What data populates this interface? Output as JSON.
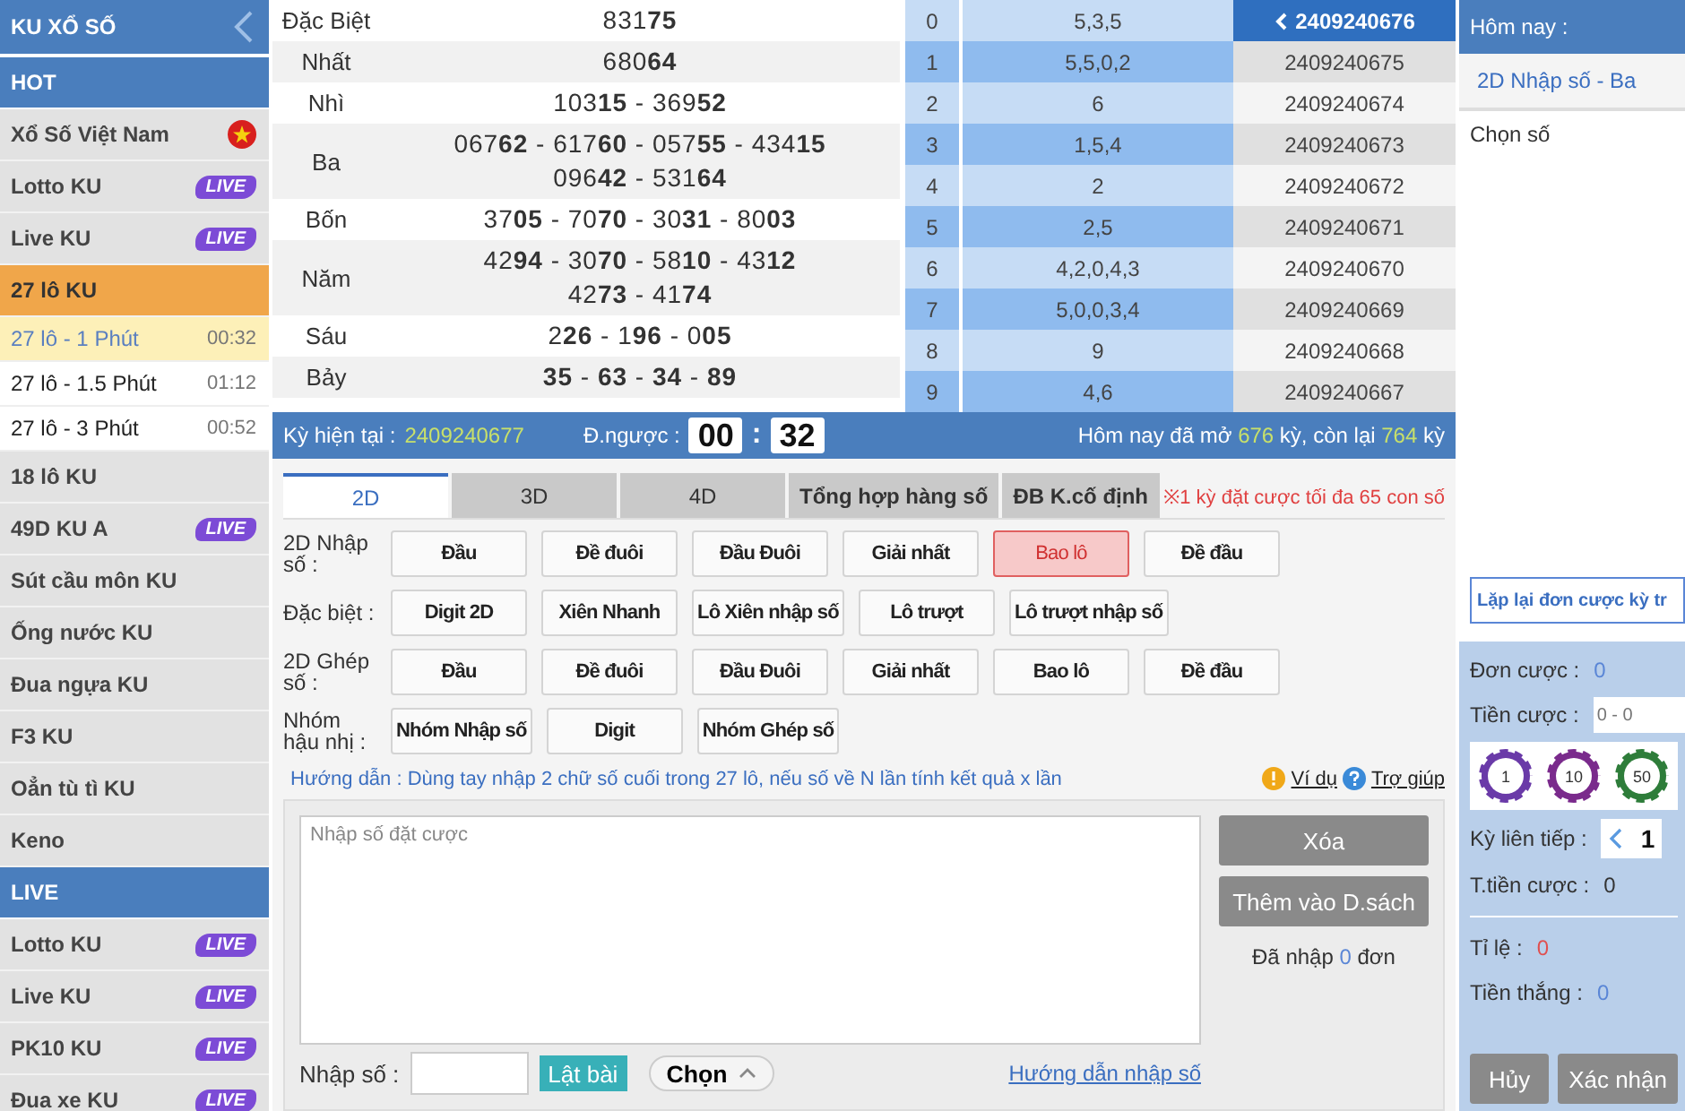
{
  "sidebar": {
    "title": "KU XỔ SỐ",
    "items": [
      {
        "kind": "section",
        "label": "HOT"
      },
      {
        "kind": "flag",
        "label": "Xổ Số Việt Nam",
        "selected": false
      },
      {
        "kind": "item",
        "label": "Lotto KU",
        "badge": "LIVE",
        "selected": false
      },
      {
        "kind": "item",
        "label": "Live KU",
        "badge": "LIVE",
        "selected": false
      },
      {
        "kind": "item",
        "label": "27 lô KU",
        "selected": true,
        "children": [
          {
            "label": "27 lô - 1 Phút",
            "time": "00:32",
            "selected": true
          },
          {
            "label": "27 lô - 1.5 Phút",
            "time": "01:12",
            "selected": false
          },
          {
            "label": "27 lô - 3 Phút",
            "time": "00:52",
            "selected": false
          }
        ]
      },
      {
        "kind": "item",
        "label": "18 lô KU",
        "selected": false
      },
      {
        "kind": "item",
        "label": "49D KU A",
        "badge": "LIVE",
        "selected": false
      },
      {
        "kind": "item",
        "label": "Sút cầu môn KU",
        "selected": false
      },
      {
        "kind": "item",
        "label": "Ống nước KU",
        "selected": false
      },
      {
        "kind": "item",
        "label": "Đua ngựa KU",
        "selected": false
      },
      {
        "kind": "item",
        "label": "F3 KU",
        "selected": false
      },
      {
        "kind": "item",
        "label": "Oẳn tù tì KU",
        "selected": false
      },
      {
        "kind": "item",
        "label": "Keno",
        "selected": false
      },
      {
        "kind": "section",
        "label": "LIVE"
      },
      {
        "kind": "item",
        "label": "Lotto KU",
        "badge": "LIVE",
        "selected": false
      },
      {
        "kind": "item",
        "label": "Live KU",
        "badge": "LIVE",
        "selected": false
      },
      {
        "kind": "item",
        "label": "PK10 KU",
        "badge": "LIVE",
        "selected": false
      },
      {
        "kind": "item",
        "label": "Đua xe KU",
        "badge": "LIVE",
        "selected": false
      }
    ]
  },
  "prizes": [
    {
      "label": "Đặc Biệt",
      "lines": [
        "831**75**"
      ]
    },
    {
      "label": "Nhất",
      "lines": [
        "680**64**"
      ]
    },
    {
      "label": "Nhì",
      "lines": [
        "103**15** - 369**52**"
      ]
    },
    {
      "label": "Ba",
      "lines": [
        "067**62** - 617**60** - 057**55** - 434**15**",
        "096**42** - 531**64**"
      ]
    },
    {
      "label": "Bốn",
      "lines": [
        "37**05** - 70**70** - 30**31** - 80**03**"
      ]
    },
    {
      "label": "Năm",
      "lines": [
        "42**94** - 30**70** - 58**10** - 43**12**",
        "42**73** - 41**74**"
      ]
    },
    {
      "label": "Sáu",
      "lines": [
        "2**26** - 1**96** - 0**05**"
      ]
    },
    {
      "label": "Bảy",
      "lines": [
        "**35** - **63** - **34** - **89**"
      ]
    }
  ],
  "digits": [
    {
      "digit": "0",
      "values": "5,3,5"
    },
    {
      "digit": "1",
      "values": "5,5,0,2"
    },
    {
      "digit": "2",
      "values": "6"
    },
    {
      "digit": "3",
      "values": "1,5,4"
    },
    {
      "digit": "4",
      "values": "2"
    },
    {
      "digit": "5",
      "values": "2,5"
    },
    {
      "digit": "6",
      "values": "4,2,0,4,3"
    },
    {
      "digit": "7",
      "values": "5,0,0,3,4"
    },
    {
      "digit": "8",
      "values": "9"
    },
    {
      "digit": "9",
      "values": "4,6"
    }
  ],
  "periods": [
    {
      "label": "2409240676",
      "selected": true
    },
    {
      "label": "2409240675",
      "selected": false
    },
    {
      "label": "2409240674",
      "selected": false
    },
    {
      "label": "2409240673",
      "selected": false
    },
    {
      "label": "2409240672",
      "selected": false
    },
    {
      "label": "2409240671",
      "selected": false
    },
    {
      "label": "2409240670",
      "selected": false
    },
    {
      "label": "2409240669",
      "selected": false
    },
    {
      "label": "2409240668",
      "selected": false
    },
    {
      "label": "2409240667",
      "selected": false
    }
  ],
  "status": {
    "current_label": "Kỳ hiện tại  :",
    "current": "2409240677",
    "countdown_label": "Đ.ngược :",
    "minutes": "00",
    "separator": ":",
    "seconds": "32",
    "today_prefix": "Hôm nay đã mở",
    "opened": "676",
    "today_mid": "kỳ, còn lại",
    "remaining": "764",
    "today_suffix": "kỳ"
  },
  "tabs": [
    {
      "label": "2D",
      "selected": true
    },
    {
      "label": "3D",
      "selected": false
    },
    {
      "label": "4D",
      "selected": false
    },
    {
      "label": "Tổng hợp hàng số",
      "selected": false
    },
    {
      "label": "ĐB K.cố định",
      "selected": false
    }
  ],
  "notice": "※1 kỳ đặt cược tối đa 65 con số",
  "bet_rows": [
    {
      "label": "2D Nhập số :",
      "options": [
        {
          "label": "Đầu",
          "selected": false
        },
        {
          "label": "Đề đuôi",
          "selected": false
        },
        {
          "label": "Đầu Đuôi",
          "selected": false
        },
        {
          "label": "Giải nhất",
          "selected": false
        },
        {
          "label": "Bao lô",
          "selected": true
        },
        {
          "label": "Đề đầu",
          "selected": false
        }
      ]
    },
    {
      "label": "Đặc biệt :",
      "options": [
        {
          "label": "Digit 2D",
          "selected": false
        },
        {
          "label": "Xiên Nhanh",
          "selected": false
        },
        {
          "label": "Lô Xiên nhập số",
          "selected": false
        },
        {
          "label": "Lô trượt",
          "selected": false
        },
        {
          "label": "Lô trượt nhập số",
          "selected": false
        }
      ]
    },
    {
      "label": "2D Ghép số :",
      "options": [
        {
          "label": "Đầu",
          "selected": false
        },
        {
          "label": "Đề đuôi",
          "selected": false
        },
        {
          "label": "Đầu Đuôi",
          "selected": false
        },
        {
          "label": "Giải nhất",
          "selected": false
        },
        {
          "label": "Bao lô",
          "selected": false
        },
        {
          "label": "Đề đầu",
          "selected": false
        }
      ]
    },
    {
      "label": "Nhóm hậu nhị :",
      "options": [
        {
          "label": "Nhóm Nhập số",
          "selected": false
        },
        {
          "label": "Digit",
          "selected": false
        },
        {
          "label": "Nhóm Ghép số",
          "selected": false
        }
      ]
    }
  ],
  "guide": {
    "text": "Hướng dẫn : Dùng tay nhập 2 chữ số cuối trong 27 lô, nếu số về N lần tính kết quả x lần",
    "example": "Ví dụ",
    "help": "Trợ giúp"
  },
  "entry": {
    "placeholder": "Nhập số đặt cược",
    "clear": "Xóa",
    "add": "Thêm vào D.sách",
    "count_prefix": "Đã nhập",
    "count": "0",
    "count_suffix": "đơn",
    "input_label": "Nhập số :",
    "flip": "Lật bài",
    "choose": "Chọn",
    "howto": "Hướng dẫn nhập số"
  },
  "right": {
    "header": "Hôm nay :",
    "tab": "2D Nhập số - Ba",
    "pick": "Chọn số",
    "repeat": "Lặp lại đơn cược kỳ tr",
    "bets_label": "Đơn cược :",
    "bets": "0",
    "amount_label": "Tiền cược :",
    "amount_placeholder": "0 - 0",
    "chips": [
      {
        "label": "1",
        "color": "#6a3aa8"
      },
      {
        "label": "10",
        "color": "#7a2a8c"
      },
      {
        "label": "50",
        "color": "#2e7d3a"
      }
    ],
    "streak_label": "Kỳ liên tiếp :",
    "streak": "1",
    "total_label": "T.tiền cược :",
    "total": "0",
    "rate_label": "Tỉ lệ :",
    "rate": "0",
    "win_label": "Tiền thắng :",
    "win": "0",
    "cancel": "Hủy",
    "confirm": "Xác nhận"
  }
}
